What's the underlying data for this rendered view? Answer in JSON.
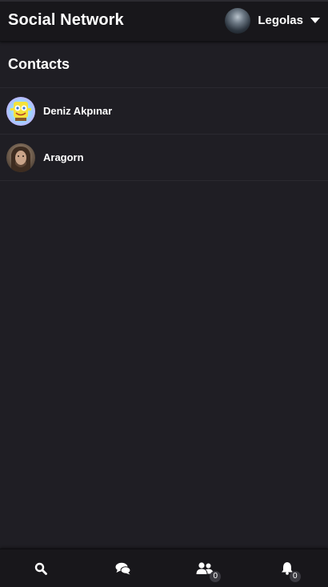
{
  "app": {
    "title": "Social Network"
  },
  "user": {
    "name": "Legolas",
    "avatar_icon": "user-avatar-image",
    "menu_icon": "caret-down-icon"
  },
  "contacts": {
    "heading": "Contacts",
    "items": [
      {
        "name": "Deniz Akpınar",
        "avatar": "spongebob-avatar"
      },
      {
        "name": "Aragorn",
        "avatar": "aragorn-avatar"
      }
    ]
  },
  "bottom_nav": {
    "items": [
      {
        "icon": "search-icon"
      },
      {
        "icon": "chat-icon"
      },
      {
        "icon": "users-icon",
        "badge": "0"
      },
      {
        "icon": "bell-icon",
        "badge": "0"
      }
    ]
  },
  "colors": {
    "background": "#1f1e24",
    "bar": "#18171b",
    "divider": "#2a2930",
    "text": "#ffffff",
    "badge": "#3a3940"
  }
}
